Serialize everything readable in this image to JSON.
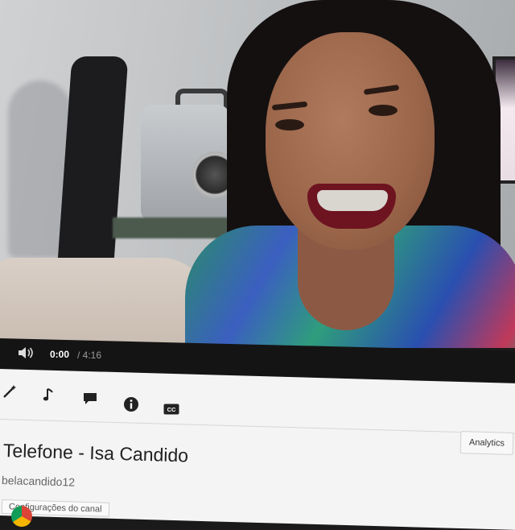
{
  "player": {
    "time_current": "0:00",
    "time_total": "/ 4:16",
    "icons": {
      "volume": "volume-icon"
    }
  },
  "toolbar": {
    "icons": [
      "magic-wand-icon",
      "music-note-icon",
      "comment-icon",
      "info-icon",
      "closed-captions-icon"
    ]
  },
  "video": {
    "title": "Telefone - Isa Candido",
    "channel": "belacandido12"
  },
  "buttons": {
    "analytics": "Analytics",
    "channel_settings": "Configurações do canal"
  },
  "colors": {
    "control_bar": "#141414",
    "page_background": "#f4f4f4"
  }
}
